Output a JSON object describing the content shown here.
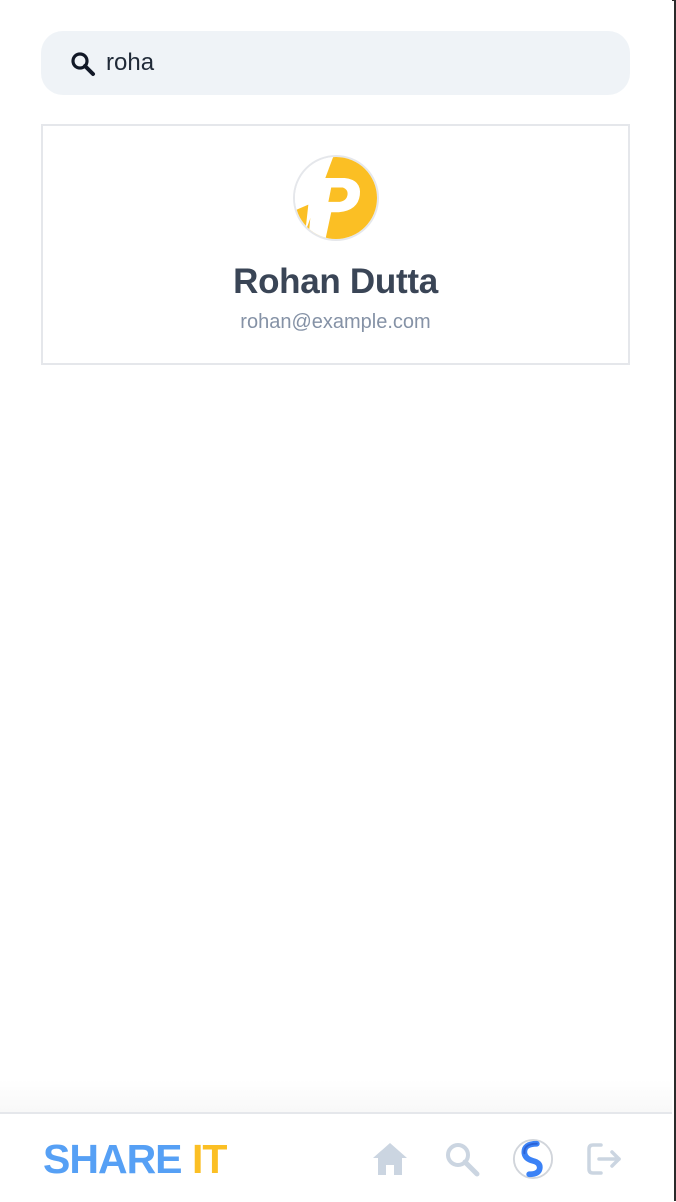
{
  "search": {
    "value": "roha",
    "icon": "search-icon"
  },
  "results": [
    {
      "name": "Rohan Dutta",
      "email": "rohan@example.com",
      "avatar_icon": "avatar-p-icon"
    }
  ],
  "bottom_nav": {
    "logo_part1": "SHARE",
    "logo_part2": "IT",
    "items": [
      {
        "icon": "home-icon"
      },
      {
        "icon": "search-icon"
      },
      {
        "icon": "profile-avatar-icon"
      },
      {
        "icon": "logout-icon"
      }
    ]
  },
  "colors": {
    "brand_blue": "#56a0f5",
    "brand_yellow": "#fbbf24",
    "search_bg": "#eff3f7",
    "nav_icon_gray": "#cbd5e1",
    "name_text": "#3a4556",
    "email_text": "#8592a6"
  }
}
